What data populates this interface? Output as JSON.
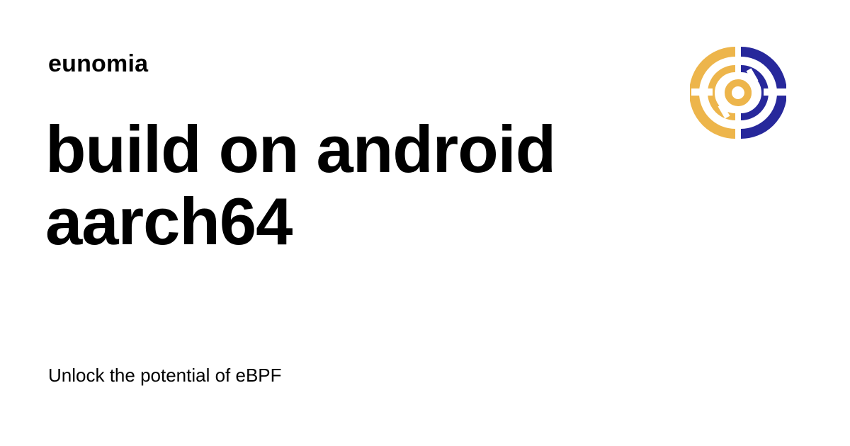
{
  "site": {
    "name": "eunomia"
  },
  "post": {
    "title": "build on android aarch64",
    "tagline": "Unlock the potential of eBPF"
  },
  "logo": {
    "icon": "eunomia-logo-icon",
    "colors": {
      "gold": "#EDB54B",
      "navy": "#27289B"
    }
  }
}
